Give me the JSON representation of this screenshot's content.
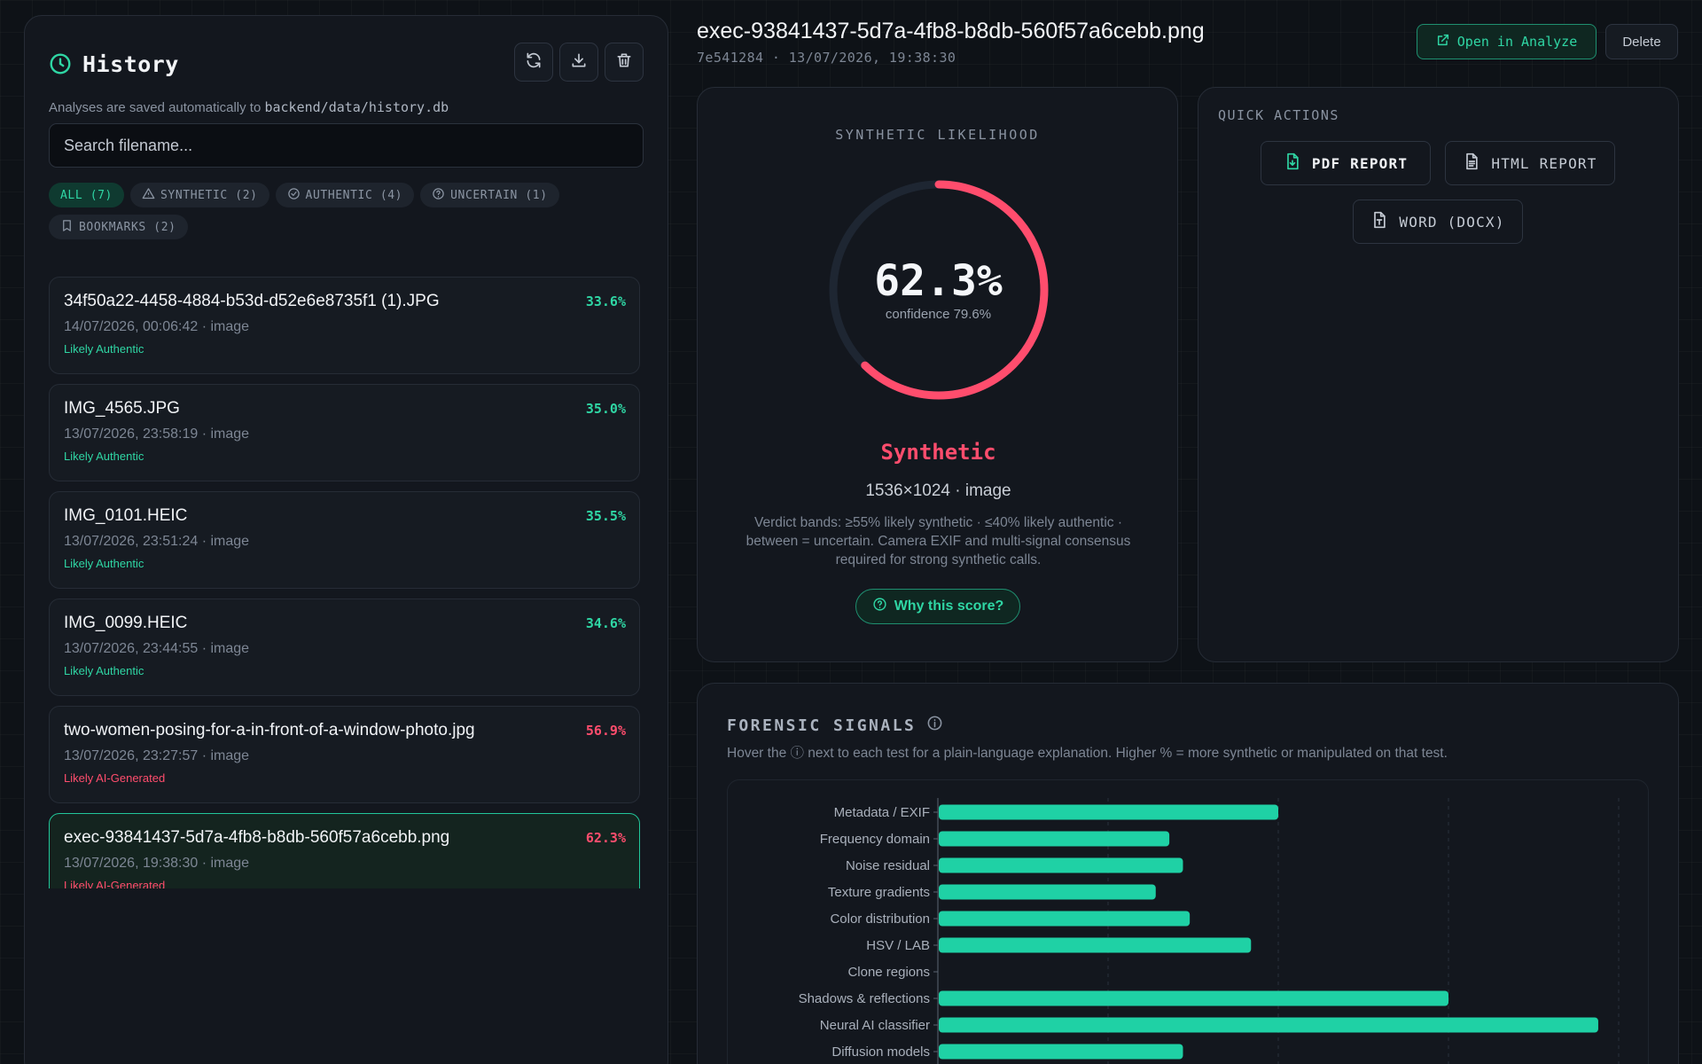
{
  "history": {
    "title": "History",
    "subtitle_prefix": "Analyses are saved automatically to",
    "subtitle_path": "backend/data/history.db",
    "search_placeholder": "Search filename...",
    "filters": [
      {
        "label": "ALL (7)",
        "icon": "none",
        "active": true
      },
      {
        "label": "SYNTHETIC (2)",
        "icon": "warning-icon"
      },
      {
        "label": "AUTHENTIC (4)",
        "icon": "check-circle-icon"
      },
      {
        "label": "UNCERTAIN (1)",
        "icon": "help-circle-icon"
      },
      {
        "label": "BOOKMARKS (2)",
        "icon": "bookmark-icon"
      }
    ],
    "items": [
      {
        "name": "34f50a22-4458-4884-b53d-d52e6e8735f1 (1).JPG",
        "meta": "14/07/2026, 00:06:42 · image",
        "verdict": "Likely Authentic",
        "score": "33.6%",
        "status": "authentic"
      },
      {
        "name": "IMG_4565.JPG",
        "meta": "13/07/2026, 23:58:19 · image",
        "verdict": "Likely Authentic",
        "score": "35.0%",
        "status": "authentic"
      },
      {
        "name": "IMG_0101.HEIC",
        "meta": "13/07/2026, 23:51:24 · image",
        "verdict": "Likely Authentic",
        "score": "35.5%",
        "status": "authentic"
      },
      {
        "name": "IMG_0099.HEIC",
        "meta": "13/07/2026, 23:44:55 · image",
        "verdict": "Likely Authentic",
        "score": "34.6%",
        "status": "authentic"
      },
      {
        "name": "two-women-posing-for-a-in-front-of-a-window-photo.jpg",
        "meta": "13/07/2026, 23:27:57 · image",
        "verdict": "Likely AI-Generated",
        "score": "56.9%",
        "status": "synthetic"
      },
      {
        "name": "exec-93841437-5d7a-4fb8-b8db-560f57a6cebb.png",
        "meta": "13/07/2026, 19:38:30 · image",
        "verdict": "Likely AI-Generated",
        "score": "62.3%",
        "status": "synthetic",
        "selected": true
      }
    ]
  },
  "detail": {
    "filename": "exec-93841437-5d7a-4fb8-b8db-560f57a6cebb.png",
    "id_line": "7e541284 · 13/07/2026, 19:38:30",
    "open_label": "Open in Analyze",
    "delete_label": "Delete"
  },
  "likelihood": {
    "label": "SYNTHETIC LIKELIHOOD",
    "value": "62.3%",
    "fraction": 0.623,
    "confidence": "confidence 79.6%",
    "verdict": "Synthetic",
    "dims": "1536×1024 · image",
    "bands": "Verdict bands: ≥55% likely synthetic · ≤40% likely authentic · between = uncertain. Camera EXIF and multi-signal consensus required for strong synthetic calls.",
    "why_label": "Why this score?"
  },
  "quick_actions": {
    "label": "QUICK ACTIONS",
    "pdf": "PDF REPORT",
    "html": "HTML REPORT",
    "word": "WORD (DOCX)"
  },
  "signals": {
    "title": "FORENSIC SIGNALS",
    "description": "Hover the ⓘ next to each test for a plain-language explanation. Higher % = more synthetic or manipulated on that test."
  },
  "chart_data": {
    "type": "bar",
    "orientation": "horizontal",
    "categories": [
      "Metadata / EXIF",
      "Frequency domain",
      "Noise residual",
      "Texture gradients",
      "Color distribution",
      "HSV / LAB",
      "Clone regions",
      "Shadows & reflections",
      "Neural AI classifier",
      "Diffusion models"
    ],
    "values": [
      50,
      34,
      36,
      32,
      37,
      46,
      0,
      75,
      97,
      36
    ],
    "xlim": [
      0,
      100
    ],
    "grid": true,
    "colors": {
      "bar": "#1fd1a5"
    }
  },
  "colors": {
    "accent": "#2fd6a4",
    "synthetic": "#ff4d6d",
    "authentic": "#2fd6a4",
    "gauge_track": "#1e2632"
  }
}
